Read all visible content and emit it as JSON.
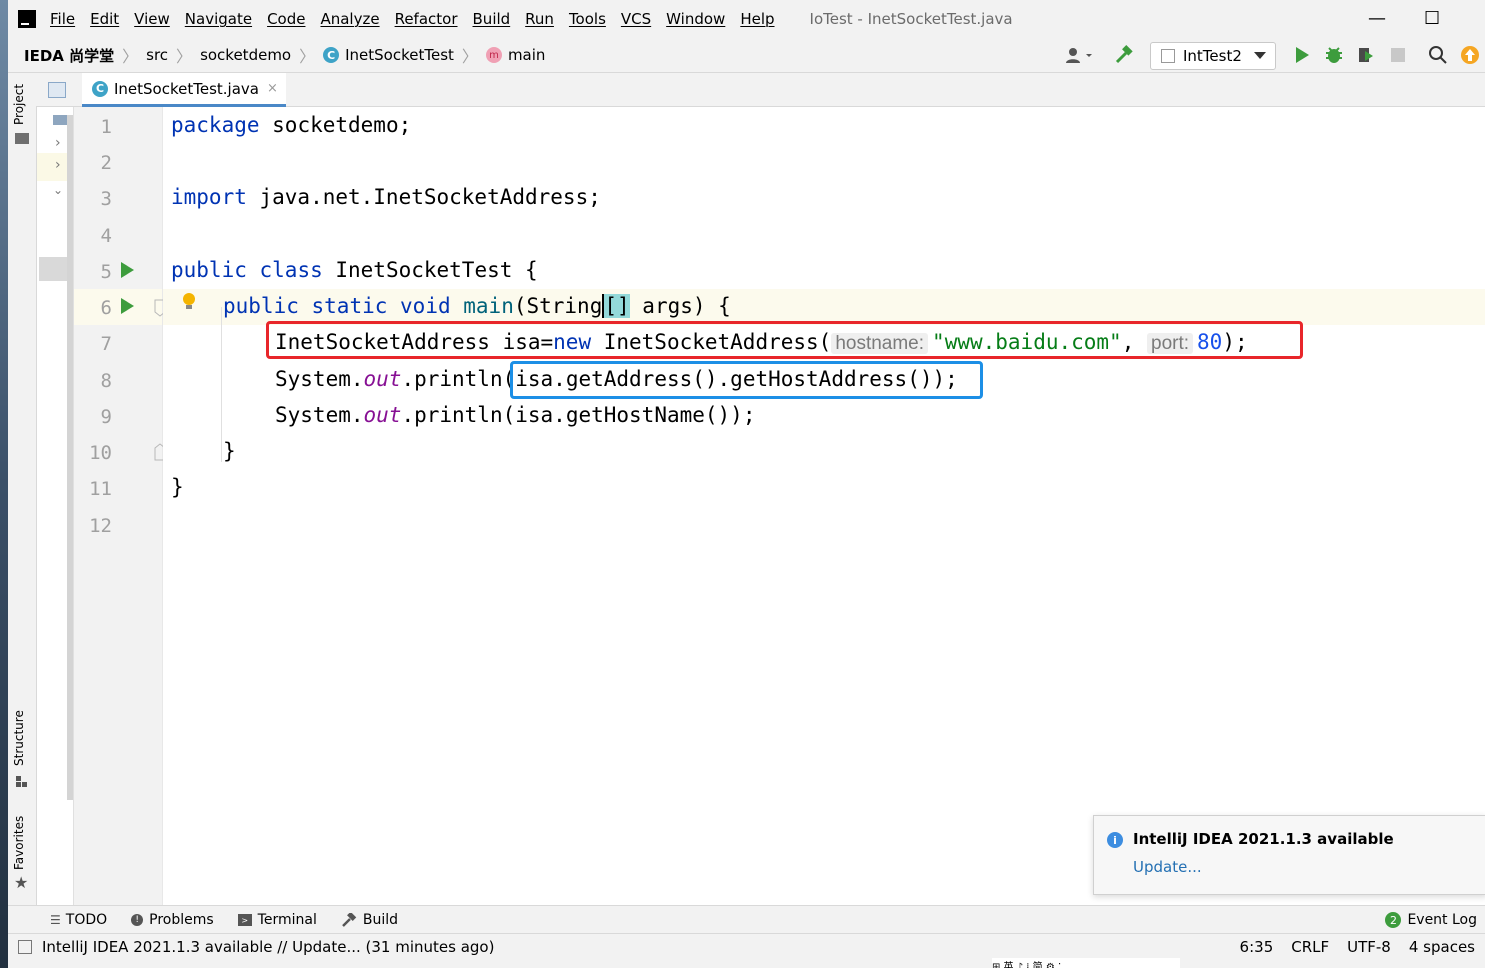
{
  "window": {
    "title": "IoTest - InetSocketTest.java",
    "minimize": "—",
    "maximize": "☐"
  },
  "menu": [
    "File",
    "Edit",
    "View",
    "Navigate",
    "Code",
    "Analyze",
    "Refactor",
    "Build",
    "Run",
    "Tools",
    "VCS",
    "Window",
    "Help"
  ],
  "breadcrumb": {
    "project": "IEDA 尚学堂",
    "src": "src",
    "package": "socketdemo",
    "class": "InetSocketTest",
    "method": "main"
  },
  "toolbar": {
    "run_config": "IntTest2",
    "colors": {
      "run": "#3d9c3d",
      "build": "#3d9c3d",
      "update": "#f5a623"
    }
  },
  "tab": {
    "label": "InetSocketTest.java",
    "close": "×"
  },
  "side_tools": {
    "project": "Project",
    "structure": "Structure",
    "favorites": "Favorites"
  },
  "editor": {
    "line_numbers": [
      "1",
      "2",
      "3",
      "4",
      "5",
      "6",
      "7",
      "8",
      "9",
      "10",
      "11",
      "12"
    ],
    "code": {
      "l1_kw": "package",
      "l1_rest": " socketdemo;",
      "l3_kw": "import",
      "l3_rest": " java.net.InetSocketAddress;",
      "l5_kw1": "public",
      "l5_kw2": "class",
      "l5_rest": " InetSocketTest {",
      "l6_kw1": "public",
      "l6_kw2": "static",
      "l6_kw3": "void",
      "l6_fn": "main",
      "l6_a": "(String",
      "l6_b": "[]",
      "l6_c": " args) {",
      "l7_a": "InetSocketAddress isa=",
      "l7_new": "new",
      "l7_b": " InetSocketAddress(",
      "l7_hint1": "hostname:",
      "l7_str": "\"www.baidu.com\"",
      "l7_comma": ", ",
      "l7_hint2": "port:",
      "l7_num": "80",
      "l7_end": ");",
      "l8_a": "System.",
      "l8_out": "out",
      "l8_b": ".println",
      "l8_c": "(isa.getAddress().getHostAddress());",
      "l9_a": "System.",
      "l9_out": "out",
      "l9_b": ".println(isa.getHostName());",
      "l10": "}",
      "l11": "}"
    },
    "highlight_colors": {
      "red_box": "#e8262a",
      "blue_box": "#1c8fe6"
    }
  },
  "bottom_tools": [
    {
      "label": "TODO",
      "icon": "list-icon"
    },
    {
      "label": "Problems",
      "icon": "problems-icon"
    },
    {
      "label": "Terminal",
      "icon": "terminal-icon"
    },
    {
      "label": "Build",
      "icon": "hammer-icon"
    }
  ],
  "event_log": {
    "count": "2",
    "label": "Event Log"
  },
  "status": {
    "message": "IntelliJ IDEA 2021.1.3 available // Update... (31 minutes ago)",
    "position": "6:35",
    "line_sep": "CRLF",
    "encoding": "UTF-8",
    "indent": "4 spaces"
  },
  "notification": {
    "title": "IntelliJ IDEA 2021.1.3 available",
    "link": "Update..."
  },
  "taskbar_fragment": "⊞ 英 ♪ ⁞ 简 ⚙ ⁚"
}
